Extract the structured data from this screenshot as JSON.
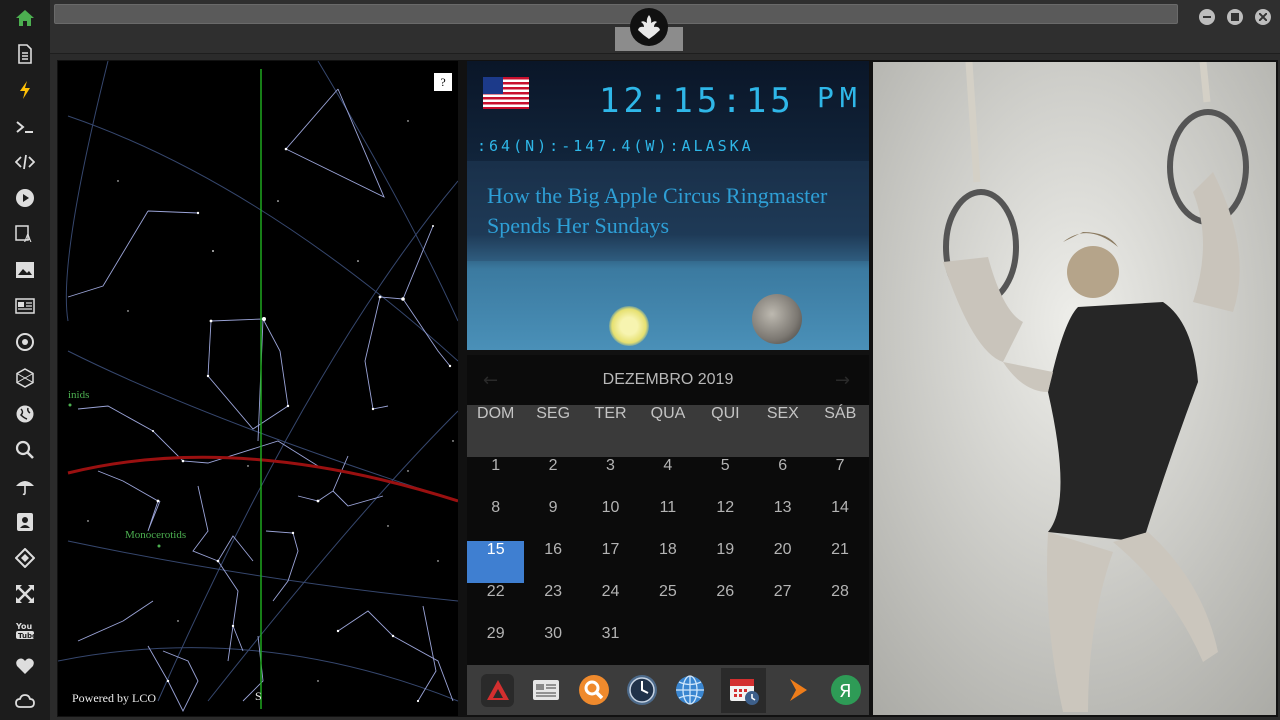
{
  "sidebar": {
    "items": [
      {
        "name": "home",
        "icon": "home-icon",
        "color": "#4caf50"
      },
      {
        "name": "document",
        "icon": "document-icon"
      },
      {
        "name": "lightning",
        "icon": "lightning-icon",
        "color": "#ffc107"
      },
      {
        "name": "terminal",
        "icon": "terminal-icon"
      },
      {
        "name": "code",
        "icon": "code-icon"
      },
      {
        "name": "play",
        "icon": "play-icon"
      },
      {
        "name": "translate",
        "icon": "translate-icon"
      },
      {
        "name": "image",
        "icon": "image-icon"
      },
      {
        "name": "news",
        "icon": "news-icon"
      },
      {
        "name": "rebel",
        "icon": "rebel-icon"
      },
      {
        "name": "hexagon",
        "icon": "hexagon-icon"
      },
      {
        "name": "globe",
        "icon": "globe-icon"
      },
      {
        "name": "search",
        "icon": "search-icon"
      },
      {
        "name": "umbrella",
        "icon": "umbrella-icon"
      },
      {
        "name": "contact",
        "icon": "contact-card-icon"
      },
      {
        "name": "tag",
        "icon": "tag-icon"
      },
      {
        "name": "expand",
        "icon": "expand-icon"
      },
      {
        "name": "youtube",
        "icon": "youtube-icon",
        "label": "You Tube"
      },
      {
        "name": "heart",
        "icon": "heart-icon"
      },
      {
        "name": "cloud",
        "icon": "cloud-icon"
      }
    ]
  },
  "sky_map": {
    "help_label": "?",
    "meteor_label_1": "inids",
    "meteor_label_2": "Monocerotids",
    "south_label": "S",
    "credit": "Powered by LCO"
  },
  "clock": {
    "time": "12:15:15",
    "ampm": "PM",
    "location": ":64(N):-147.4(W):ALASKA",
    "headline": "How the Big Apple Circus Ringmaster Spends Her Sundays",
    "flag_icon": "us-flag-icon"
  },
  "calendar": {
    "month": "DEZEMBRO 2019",
    "prev": "←",
    "next": "→",
    "weekdays": [
      "DOM",
      "SEG",
      "TER",
      "QUA",
      "QUI",
      "SEX",
      "SÁB"
    ],
    "weeks": [
      [
        "1",
        "2",
        "3",
        "4",
        "5",
        "6",
        "7"
      ],
      [
        "8",
        "9",
        "10",
        "11",
        "12",
        "13",
        "14"
      ],
      [
        "15",
        "16",
        "17",
        "18",
        "19",
        "20",
        "21"
      ],
      [
        "22",
        "23",
        "24",
        "25",
        "26",
        "27",
        "28"
      ],
      [
        "29",
        "30",
        "31",
        "",
        "",
        "",
        ""
      ]
    ],
    "today": "15",
    "today_color": "#3f7fd1"
  },
  "dock": {
    "items": [
      "app-launcher-icon",
      "news-reader-icon",
      "search-icon",
      "clock-icon",
      "globe-icon",
      "calendar-icon",
      "play-arrow-icon",
      "yandex-icon"
    ]
  },
  "colors": {
    "accent": "#2fb7e8",
    "sidebar_bg": "#1c1c1c"
  }
}
